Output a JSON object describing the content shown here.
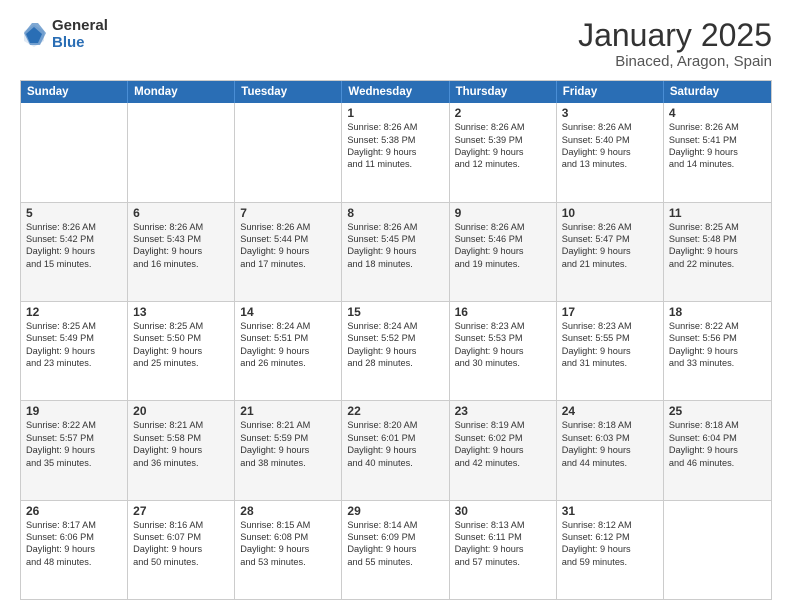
{
  "logo": {
    "general": "General",
    "blue": "Blue"
  },
  "title": "January 2025",
  "subtitle": "Binaced, Aragon, Spain",
  "header_days": [
    "Sunday",
    "Monday",
    "Tuesday",
    "Wednesday",
    "Thursday",
    "Friday",
    "Saturday"
  ],
  "weeks": [
    [
      {
        "day": "",
        "text": ""
      },
      {
        "day": "",
        "text": ""
      },
      {
        "day": "",
        "text": ""
      },
      {
        "day": "1",
        "text": "Sunrise: 8:26 AM\nSunset: 5:38 PM\nDaylight: 9 hours\nand 11 minutes."
      },
      {
        "day": "2",
        "text": "Sunrise: 8:26 AM\nSunset: 5:39 PM\nDaylight: 9 hours\nand 12 minutes."
      },
      {
        "day": "3",
        "text": "Sunrise: 8:26 AM\nSunset: 5:40 PM\nDaylight: 9 hours\nand 13 minutes."
      },
      {
        "day": "4",
        "text": "Sunrise: 8:26 AM\nSunset: 5:41 PM\nDaylight: 9 hours\nand 14 minutes."
      }
    ],
    [
      {
        "day": "5",
        "text": "Sunrise: 8:26 AM\nSunset: 5:42 PM\nDaylight: 9 hours\nand 15 minutes."
      },
      {
        "day": "6",
        "text": "Sunrise: 8:26 AM\nSunset: 5:43 PM\nDaylight: 9 hours\nand 16 minutes."
      },
      {
        "day": "7",
        "text": "Sunrise: 8:26 AM\nSunset: 5:44 PM\nDaylight: 9 hours\nand 17 minutes."
      },
      {
        "day": "8",
        "text": "Sunrise: 8:26 AM\nSunset: 5:45 PM\nDaylight: 9 hours\nand 18 minutes."
      },
      {
        "day": "9",
        "text": "Sunrise: 8:26 AM\nSunset: 5:46 PM\nDaylight: 9 hours\nand 19 minutes."
      },
      {
        "day": "10",
        "text": "Sunrise: 8:26 AM\nSunset: 5:47 PM\nDaylight: 9 hours\nand 21 minutes."
      },
      {
        "day": "11",
        "text": "Sunrise: 8:25 AM\nSunset: 5:48 PM\nDaylight: 9 hours\nand 22 minutes."
      }
    ],
    [
      {
        "day": "12",
        "text": "Sunrise: 8:25 AM\nSunset: 5:49 PM\nDaylight: 9 hours\nand 23 minutes."
      },
      {
        "day": "13",
        "text": "Sunrise: 8:25 AM\nSunset: 5:50 PM\nDaylight: 9 hours\nand 25 minutes."
      },
      {
        "day": "14",
        "text": "Sunrise: 8:24 AM\nSunset: 5:51 PM\nDaylight: 9 hours\nand 26 minutes."
      },
      {
        "day": "15",
        "text": "Sunrise: 8:24 AM\nSunset: 5:52 PM\nDaylight: 9 hours\nand 28 minutes."
      },
      {
        "day": "16",
        "text": "Sunrise: 8:23 AM\nSunset: 5:53 PM\nDaylight: 9 hours\nand 30 minutes."
      },
      {
        "day": "17",
        "text": "Sunrise: 8:23 AM\nSunset: 5:55 PM\nDaylight: 9 hours\nand 31 minutes."
      },
      {
        "day": "18",
        "text": "Sunrise: 8:22 AM\nSunset: 5:56 PM\nDaylight: 9 hours\nand 33 minutes."
      }
    ],
    [
      {
        "day": "19",
        "text": "Sunrise: 8:22 AM\nSunset: 5:57 PM\nDaylight: 9 hours\nand 35 minutes."
      },
      {
        "day": "20",
        "text": "Sunrise: 8:21 AM\nSunset: 5:58 PM\nDaylight: 9 hours\nand 36 minutes."
      },
      {
        "day": "21",
        "text": "Sunrise: 8:21 AM\nSunset: 5:59 PM\nDaylight: 9 hours\nand 38 minutes."
      },
      {
        "day": "22",
        "text": "Sunrise: 8:20 AM\nSunset: 6:01 PM\nDaylight: 9 hours\nand 40 minutes."
      },
      {
        "day": "23",
        "text": "Sunrise: 8:19 AM\nSunset: 6:02 PM\nDaylight: 9 hours\nand 42 minutes."
      },
      {
        "day": "24",
        "text": "Sunrise: 8:18 AM\nSunset: 6:03 PM\nDaylight: 9 hours\nand 44 minutes."
      },
      {
        "day": "25",
        "text": "Sunrise: 8:18 AM\nSunset: 6:04 PM\nDaylight: 9 hours\nand 46 minutes."
      }
    ],
    [
      {
        "day": "26",
        "text": "Sunrise: 8:17 AM\nSunset: 6:06 PM\nDaylight: 9 hours\nand 48 minutes."
      },
      {
        "day": "27",
        "text": "Sunrise: 8:16 AM\nSunset: 6:07 PM\nDaylight: 9 hours\nand 50 minutes."
      },
      {
        "day": "28",
        "text": "Sunrise: 8:15 AM\nSunset: 6:08 PM\nDaylight: 9 hours\nand 53 minutes."
      },
      {
        "day": "29",
        "text": "Sunrise: 8:14 AM\nSunset: 6:09 PM\nDaylight: 9 hours\nand 55 minutes."
      },
      {
        "day": "30",
        "text": "Sunrise: 8:13 AM\nSunset: 6:11 PM\nDaylight: 9 hours\nand 57 minutes."
      },
      {
        "day": "31",
        "text": "Sunrise: 8:12 AM\nSunset: 6:12 PM\nDaylight: 9 hours\nand 59 minutes."
      },
      {
        "day": "",
        "text": ""
      }
    ]
  ]
}
